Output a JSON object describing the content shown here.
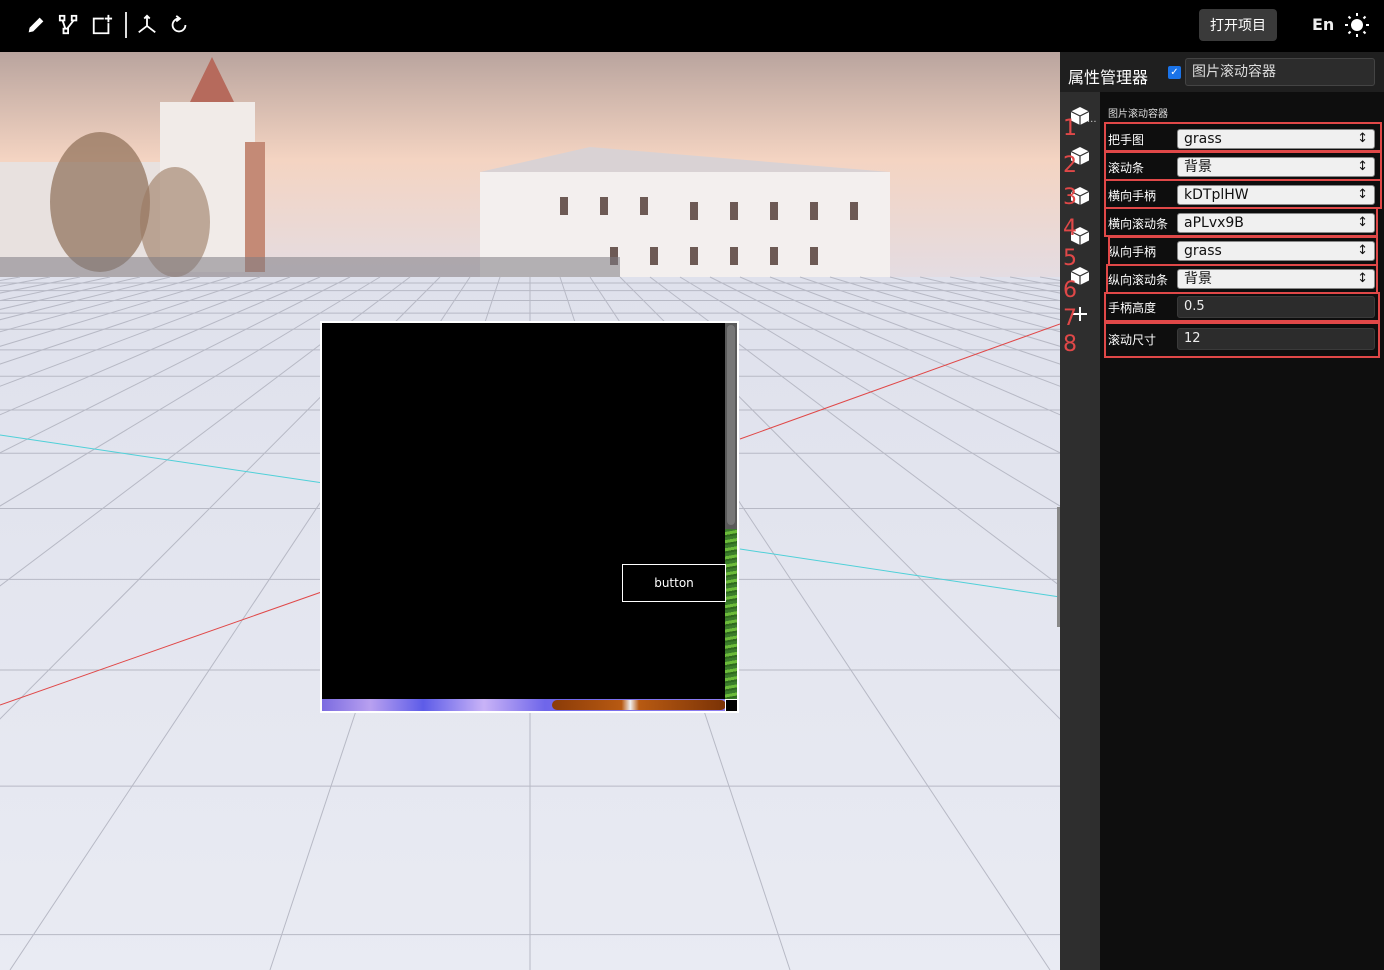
{
  "toolbar": {
    "tools": [
      "pencil-icon",
      "vector-edit-icon",
      "add-node-icon",
      "axis-icon",
      "refresh-icon"
    ],
    "open_project_label": "打开项目",
    "language_label": "En",
    "theme_icon": "sun-icon"
  },
  "viewport": {
    "scroll_button_label": "button"
  },
  "panel": {
    "title": "属性管理器",
    "enabled": true,
    "component_name": "图片滚动容器",
    "section_title": "图片滚动容器",
    "rail_more": "...",
    "properties": [
      {
        "label": "把手图",
        "value": "grass",
        "kind": "select"
      },
      {
        "label": "滚动条",
        "value": "背景",
        "kind": "select"
      },
      {
        "label": "横向手柄",
        "value": "kDTplHW",
        "kind": "select"
      },
      {
        "label": "横向滚动条",
        "value": "aPLvx9B",
        "kind": "select"
      },
      {
        "label": "纵向手柄",
        "value": "grass",
        "kind": "select"
      },
      {
        "label": "纵向滚动条",
        "value": "背景",
        "kind": "select"
      },
      {
        "label": "手柄高度",
        "value": "0.5",
        "kind": "input"
      },
      {
        "label": "滚动尺寸",
        "value": "12",
        "kind": "input"
      }
    ],
    "annotation_numbers": [
      "1",
      "2",
      "3",
      "4",
      "5",
      "6",
      "7",
      "8"
    ]
  },
  "colors": {
    "highlight": "#e04848",
    "checkbox": "#1a73e8",
    "panel_bg": "#0e0e0e"
  }
}
